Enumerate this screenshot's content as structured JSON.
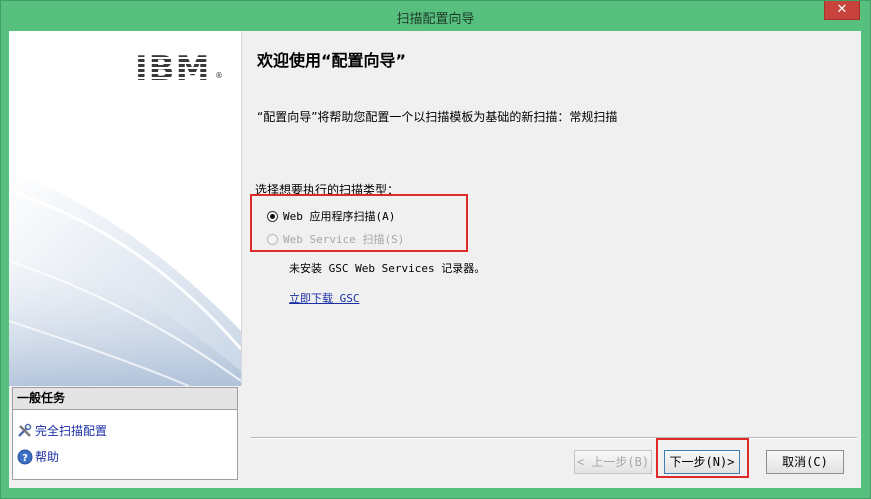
{
  "window": {
    "title": "扫描配置向导",
    "close_symbol": "✕"
  },
  "left": {
    "logo_text": "IBM",
    "logo_mark": "®",
    "tasks": {
      "header": "一般任务",
      "items": [
        {
          "label": "完全扫描配置",
          "icon": "tools-icon"
        },
        {
          "label": "帮助",
          "icon": "help-icon"
        }
      ]
    }
  },
  "main": {
    "heading": "欢迎使用“配置向导”",
    "description": "“配置向导”将帮助您配置一个以扫描模板为基础的新扫描：常规扫描",
    "scan_type_label": "选择想要执行的扫描类型：",
    "options": [
      {
        "label": "Web 应用程序扫描(A)",
        "checked": true,
        "enabled": true
      },
      {
        "label": "Web Service 扫描(S)",
        "checked": false,
        "enabled": false
      }
    ],
    "note": "未安装 GSC Web Services 记录器。",
    "link": "立即下载 GSC"
  },
  "buttons": {
    "back": "< 上一步(B)",
    "next": "下一步(N)>",
    "cancel": "取消(C)"
  },
  "colors": {
    "frame": "#58c07f",
    "close": "#c7433b",
    "highlight": "#e02a2a",
    "link": "#1a2ea6"
  }
}
